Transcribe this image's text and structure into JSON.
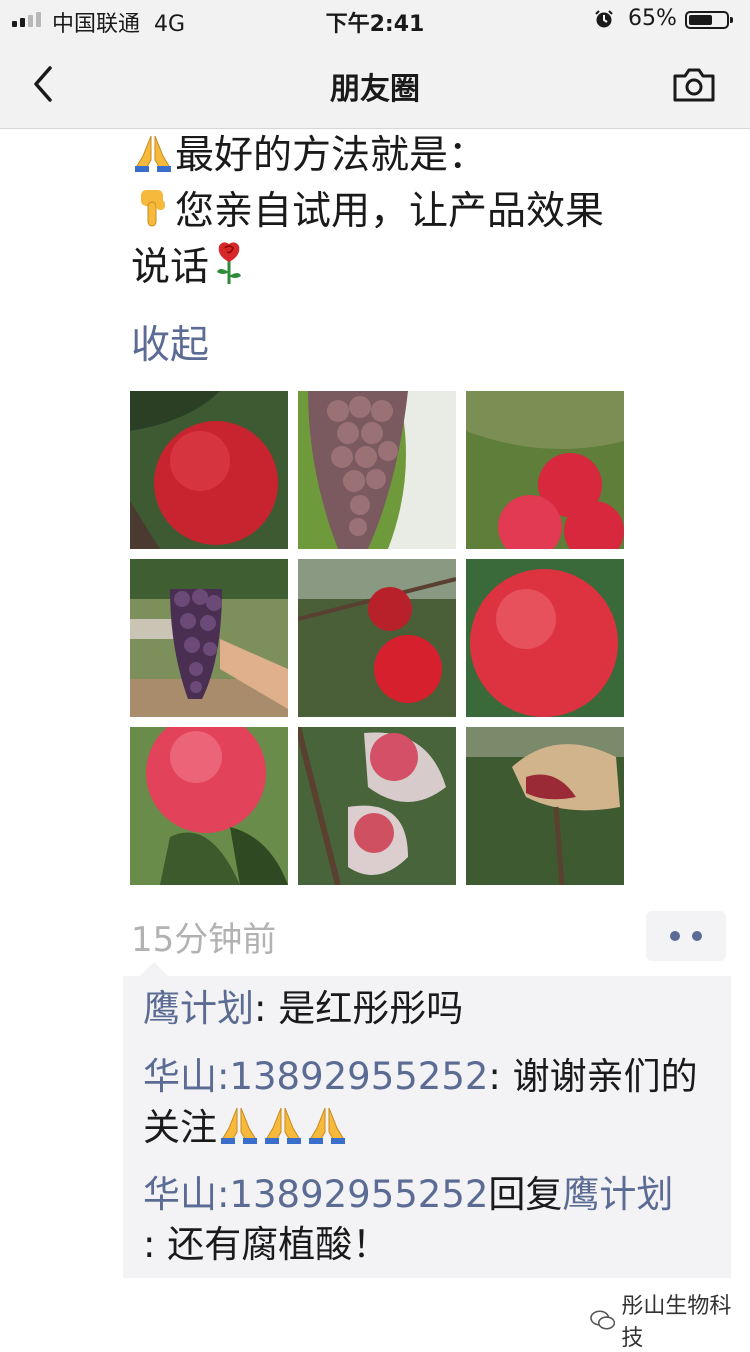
{
  "status_bar": {
    "carrier": "中国联通",
    "network": "4G",
    "time": "下午2:41",
    "battery": "65%",
    "battery_level": 0.65,
    "icons": [
      "signal-icon",
      "alarm-icon",
      "battery-icon"
    ]
  },
  "nav": {
    "title": "朋友圈",
    "back_icon": "chevron-left-icon",
    "camera_icon": "camera-icon"
  },
  "post": {
    "lines": [
      {
        "emoji": "pray",
        "text": "最好的方法就是："
      },
      {
        "emoji": "point-down",
        "text": "您亲自试用，让产品效果"
      },
      {
        "emoji": "",
        "text": "说话",
        "trailing_emoji": "rose"
      }
    ],
    "collapse_label": "收起",
    "photos": [
      {
        "name": "photo-red-apple-closeup"
      },
      {
        "name": "photo-purple-grape-bunch"
      },
      {
        "name": "photo-apples-on-grass"
      },
      {
        "name": "photo-grape-in-hand"
      },
      {
        "name": "photo-apple-on-tree-branch"
      },
      {
        "name": "photo-large-red-apple"
      },
      {
        "name": "photo-apple-with-leaves"
      },
      {
        "name": "photo-bagged-apples"
      },
      {
        "name": "photo-apple-paper-bag"
      }
    ],
    "time": "15分钟前",
    "more_icon": "more-dots-icon"
  },
  "comments": [
    {
      "user": "鹰计划",
      "sep": ":",
      "text": " 是红彤彤吗"
    },
    {
      "user": "华山:13892955252",
      "sep": ":",
      "text": " 谢谢亲们的关注",
      "emojis": 3
    },
    {
      "user": "华山:13892955252",
      "reply_word": "回复",
      "reply_to": "鹰计划",
      "text": ": 还有腐植酸！"
    }
  ],
  "watermark": {
    "icon": "wechat-official-account-icon",
    "text": "彤山生物科技"
  },
  "colors": {
    "link": "#5b6b93",
    "bar": "#f2f2f2",
    "comment_bg": "#f3f3f5",
    "time_gray": "#b2b2b2"
  }
}
